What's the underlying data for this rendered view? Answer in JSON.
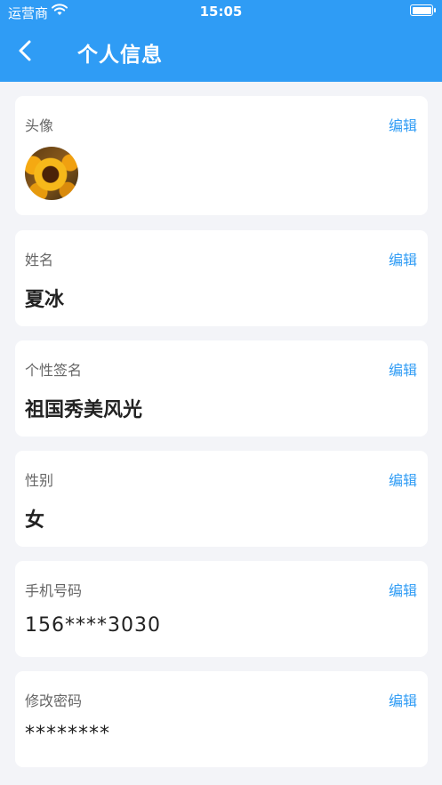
{
  "status_bar": {
    "carrier": "运营商",
    "time": "15:05"
  },
  "header": {
    "title": "个人信息"
  },
  "cards": {
    "avatar": {
      "label": "头像",
      "edit": "编辑"
    },
    "name": {
      "label": "姓名",
      "edit": "编辑",
      "value": "夏冰"
    },
    "signature": {
      "label": "个性签名",
      "edit": "编辑",
      "value": "祖国秀美风光"
    },
    "gender": {
      "label": "性别",
      "edit": "编辑",
      "value": "女"
    },
    "phone": {
      "label": "手机号码",
      "edit": "编辑",
      "value": "156****3030"
    },
    "password": {
      "label": "修改密码",
      "edit": "编辑",
      "value": "********"
    }
  },
  "colors": {
    "accent": "#2f9cf5",
    "background": "#f3f4f8"
  },
  "icons": [
    "wifi-icon",
    "battery-icon",
    "back-arrow-icon"
  ]
}
